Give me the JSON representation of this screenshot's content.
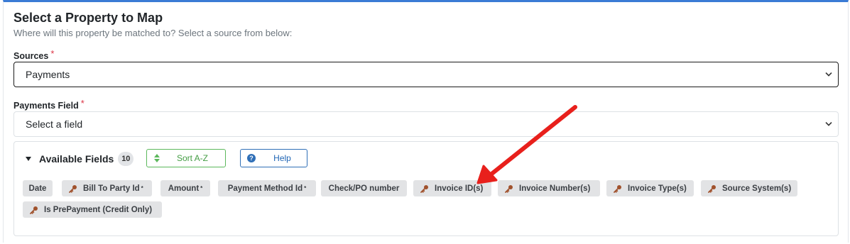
{
  "header": {
    "title": "Select a Property to Map",
    "subtitle": "Where will this property be matched to? Select a source from below:"
  },
  "sources": {
    "label": "Sources",
    "required_marker": "*",
    "value": "Payments"
  },
  "payments_field": {
    "label": "Payments Field",
    "required_marker": "*",
    "placeholder": "Select a field"
  },
  "available_fields": {
    "label": "Available Fields",
    "count": "10",
    "sort_label": "Sort A-Z",
    "help_label": "Help",
    "help_icon_glyph": "?",
    "fields": [
      {
        "label": "Date",
        "key": false,
        "required": ""
      },
      {
        "label": "Bill To Party Id",
        "key": true,
        "required": "*"
      },
      {
        "label": "Amount",
        "key": false,
        "required": "*"
      },
      {
        "label": "Payment Method Id",
        "key": false,
        "required": "*"
      },
      {
        "label": "Check/PO number",
        "key": false,
        "required": ""
      },
      {
        "label": "Invoice ID(s)",
        "key": true,
        "required": ""
      },
      {
        "label": "Invoice Number(s)",
        "key": true,
        "required": ""
      },
      {
        "label": "Invoice Type(s)",
        "key": true,
        "required": ""
      },
      {
        "label": "Source System(s)",
        "key": true,
        "required": ""
      },
      {
        "label": "Is PrePayment (Credit Only)",
        "key": true,
        "required": ""
      }
    ]
  },
  "colors": {
    "accent_border": "#3a7bd5",
    "required": "#dc3545",
    "sort_green": "#5cb85c",
    "help_blue": "#2f6fb7",
    "key_icon": "#a0522d",
    "annotation_arrow": "#e8201c"
  }
}
